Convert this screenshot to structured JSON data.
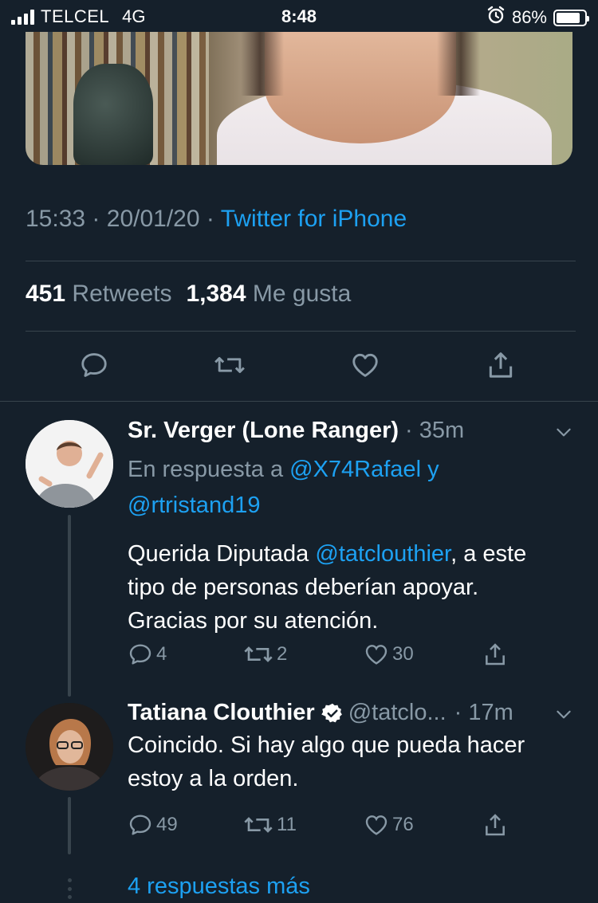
{
  "status_bar": {
    "carrier": "TELCEL",
    "network": "4G",
    "time": "8:48",
    "battery": "86%",
    "battery_level": 0.86,
    "icons": [
      "signal-icon",
      "alarm-icon",
      "battery-icon"
    ]
  },
  "tweet": {
    "time": "15:33",
    "date": "20/01/20",
    "separator": "·",
    "source": "Twitter for iPhone",
    "retweets_count": "451",
    "retweets_label": "Retweets",
    "likes_count": "1,384",
    "likes_label": "Me gusta",
    "action_icons": [
      "reply-icon",
      "retweet-icon",
      "like-icon",
      "share-icon"
    ]
  },
  "replies": [
    {
      "name": "Sr. Verger (Lone Ranger)",
      "time": "· 35m",
      "replying_prefix": "En respuesta a",
      "replying_to_1": "@X74Rafael",
      "replying_joiner": "y",
      "replying_to_2": "@rtristand19",
      "body_line1_pre": "Querida Diputada ",
      "body_mention": "@tatclouthier",
      "body_line1_post": ", a este",
      "body_line2": "tipo de personas deberían apoyar.",
      "body_line3": "Gracias por su atención.",
      "reply_count": "4",
      "retweet_count": "2",
      "like_count": "30"
    },
    {
      "name": "Tatiana Clouthier",
      "handle": "@tatclo...",
      "time": "· 17m",
      "body_line1": "Coincido. Si hay algo que pueda hacer",
      "body_line2": "estoy a la orden.",
      "reply_count": "49",
      "retweet_count": "11",
      "like_count": "76"
    }
  ],
  "more_replies": "4 respuestas más",
  "colors": {
    "background": "#15202b",
    "accent": "#1da1f2",
    "muted": "#8899a6",
    "divider": "#38444d"
  }
}
